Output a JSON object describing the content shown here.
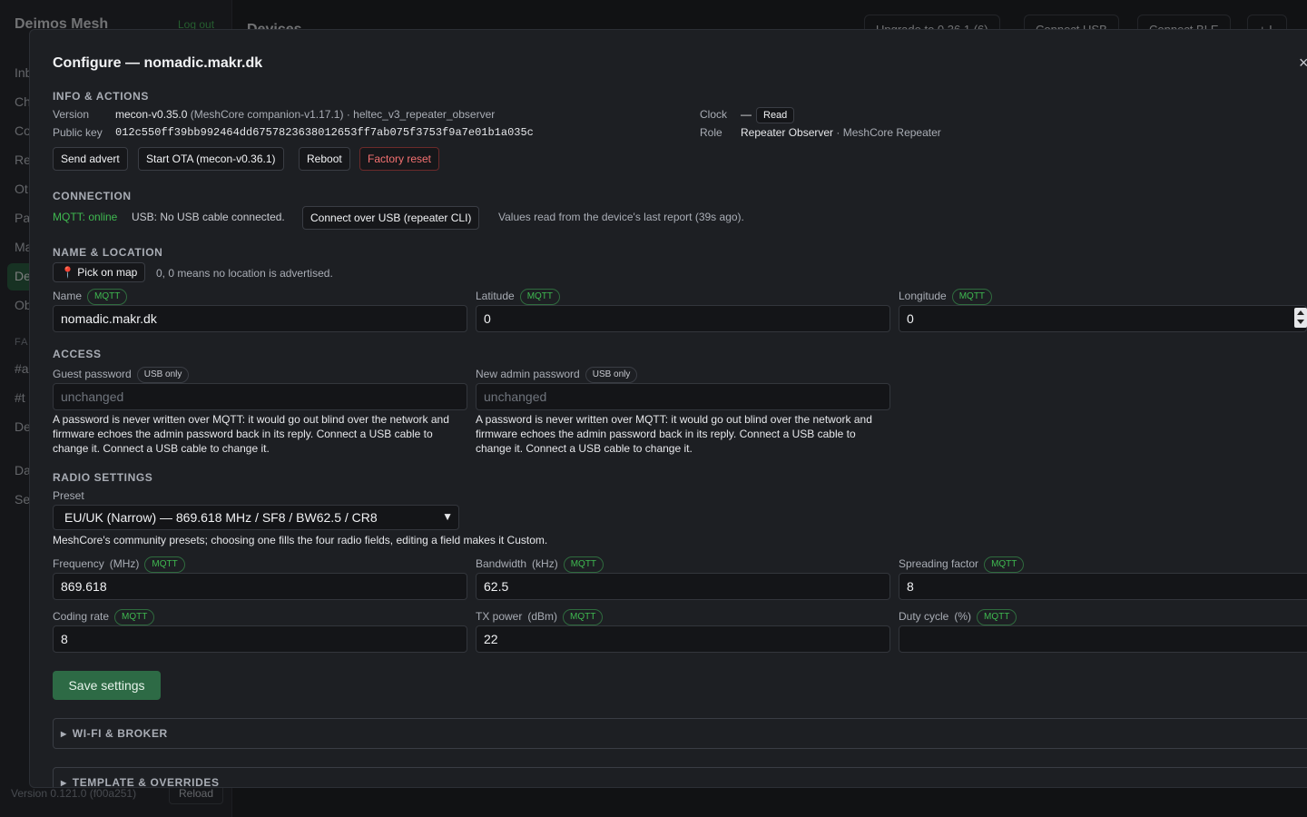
{
  "background": {
    "brand": "Deimos Mesh",
    "logout": "Log out",
    "header_title": "Devices",
    "nav": [
      "Inb",
      "Ch",
      "Co",
      "Re",
      "Ot",
      "Pa",
      "Ma",
      "De",
      "Ob"
    ],
    "section_fav": "FA",
    "fav_items": [
      "#a",
      "#t",
      "De"
    ],
    "bottom_nav": [
      "Da",
      "Se"
    ],
    "top_buttons": [
      "Upgrade to 0.36.1 (6)",
      "Connect USB",
      "Connect BLE",
      "+ L"
    ],
    "version": "Version 0.121.0 (f00a251)",
    "reload": "Reload"
  },
  "modal": {
    "title": "Configure — nomadic.makr.dk",
    "close": "×",
    "info": {
      "heading": "INFO & ACTIONS",
      "version_label": "Version",
      "version_value": "mecon-v0.35.0",
      "version_detail": "(MeshCore companion-v1.17.1) · heltec_v3_repeater_observer",
      "pubkey_label": "Public key",
      "pubkey_value": "012c550ff39bb992464dd6757823638012653ff7ab075f3753f9a7e01b1a035c",
      "clock_label": "Clock",
      "clock_value": "—",
      "clock_read": "Read",
      "role_label": "Role",
      "role_value": "Repeater Observer",
      "role_detail": "· MeshCore Repeater",
      "actions": {
        "send_advert": "Send advert",
        "start_ota": "Start OTA (mecon-v0.36.1)",
        "reboot": "Reboot",
        "factory_reset": "Factory reset"
      }
    },
    "connection": {
      "heading": "CONNECTION",
      "mqtt_status": "MQTT: online",
      "usb_status": "USB: No USB cable connected.",
      "connect_usb": "Connect over USB (repeater CLI)",
      "report_note": "Values read from the device's last report (39s ago)."
    },
    "name_location": {
      "heading": "NAME & LOCATION",
      "pick_map": "📍 Pick on map",
      "location_note": "0, 0 means no location is advertised.",
      "name_label": "Name",
      "name_value": "nomadic.makr.dk",
      "latitude_label": "Latitude",
      "latitude_value": "0",
      "longitude_label": "Longitude",
      "longitude_value": "0",
      "mqtt_badge": "MQTT"
    },
    "access": {
      "heading": "ACCESS",
      "guest_label": "Guest password",
      "admin_label": "New admin password",
      "usb_badge": "USB only",
      "placeholder": "unchanged",
      "help_text": "A password is never written over MQTT: it would go out blind over the network and firmware echoes the admin password back in its reply. Connect a USB cable to change it. Connect a USB cable to change it."
    },
    "radio": {
      "heading": "RADIO SETTINGS",
      "preset_label": "Preset",
      "preset_value": "EU/UK (Narrow) — 869.618 MHz / SF8 / BW62.5 / CR8",
      "preset_note": "MeshCore's community presets; choosing one fills the four radio fields, editing a field makes it Custom.",
      "frequency_label": "Frequency",
      "frequency_unit": "(MHz)",
      "frequency_value": "869.618",
      "bandwidth_label": "Bandwidth",
      "bandwidth_unit": "(kHz)",
      "bandwidth_value": "62.5",
      "sf_label": "Spreading factor",
      "sf_value": "8",
      "cr_label": "Coding rate",
      "cr_value": "8",
      "tx_label": "TX power",
      "tx_unit": "(dBm)",
      "tx_value": "22",
      "duty_label": "Duty cycle",
      "duty_unit": "(%)",
      "duty_value": "",
      "mqtt_badge": "MQTT",
      "save": "Save settings"
    },
    "sections": {
      "wifi": "WI-FI & BROKER",
      "template": "TEMPLATE & OVERRIDES"
    }
  }
}
